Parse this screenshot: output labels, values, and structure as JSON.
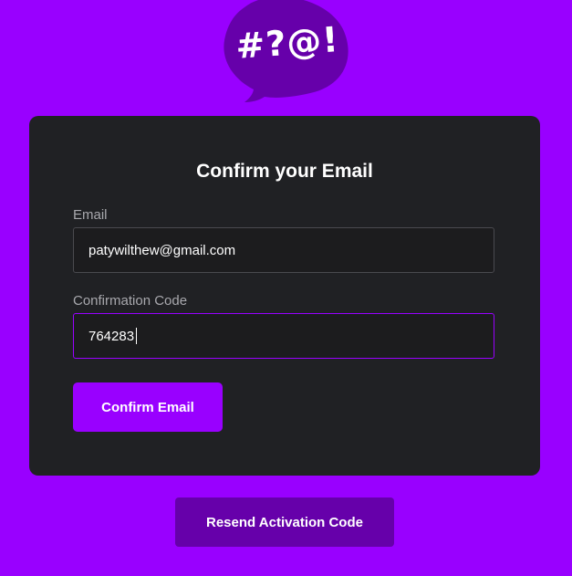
{
  "theme": {
    "background": "#9900ff",
    "card_background": "#202124",
    "accent": "#9900ff",
    "secondary_button": "#6600aa",
    "logo_bubble": "#6600aa"
  },
  "logo": {
    "icon": "speech-bubble-icon",
    "symbols": "#?@!"
  },
  "form": {
    "title": "Confirm your Email",
    "email_label": "Email",
    "email_value": "patywilthew@gmail.com",
    "code_label": "Confirmation Code",
    "code_value": "764283",
    "submit_label": "Confirm Email"
  },
  "resend": {
    "label": "Resend Activation Code"
  }
}
